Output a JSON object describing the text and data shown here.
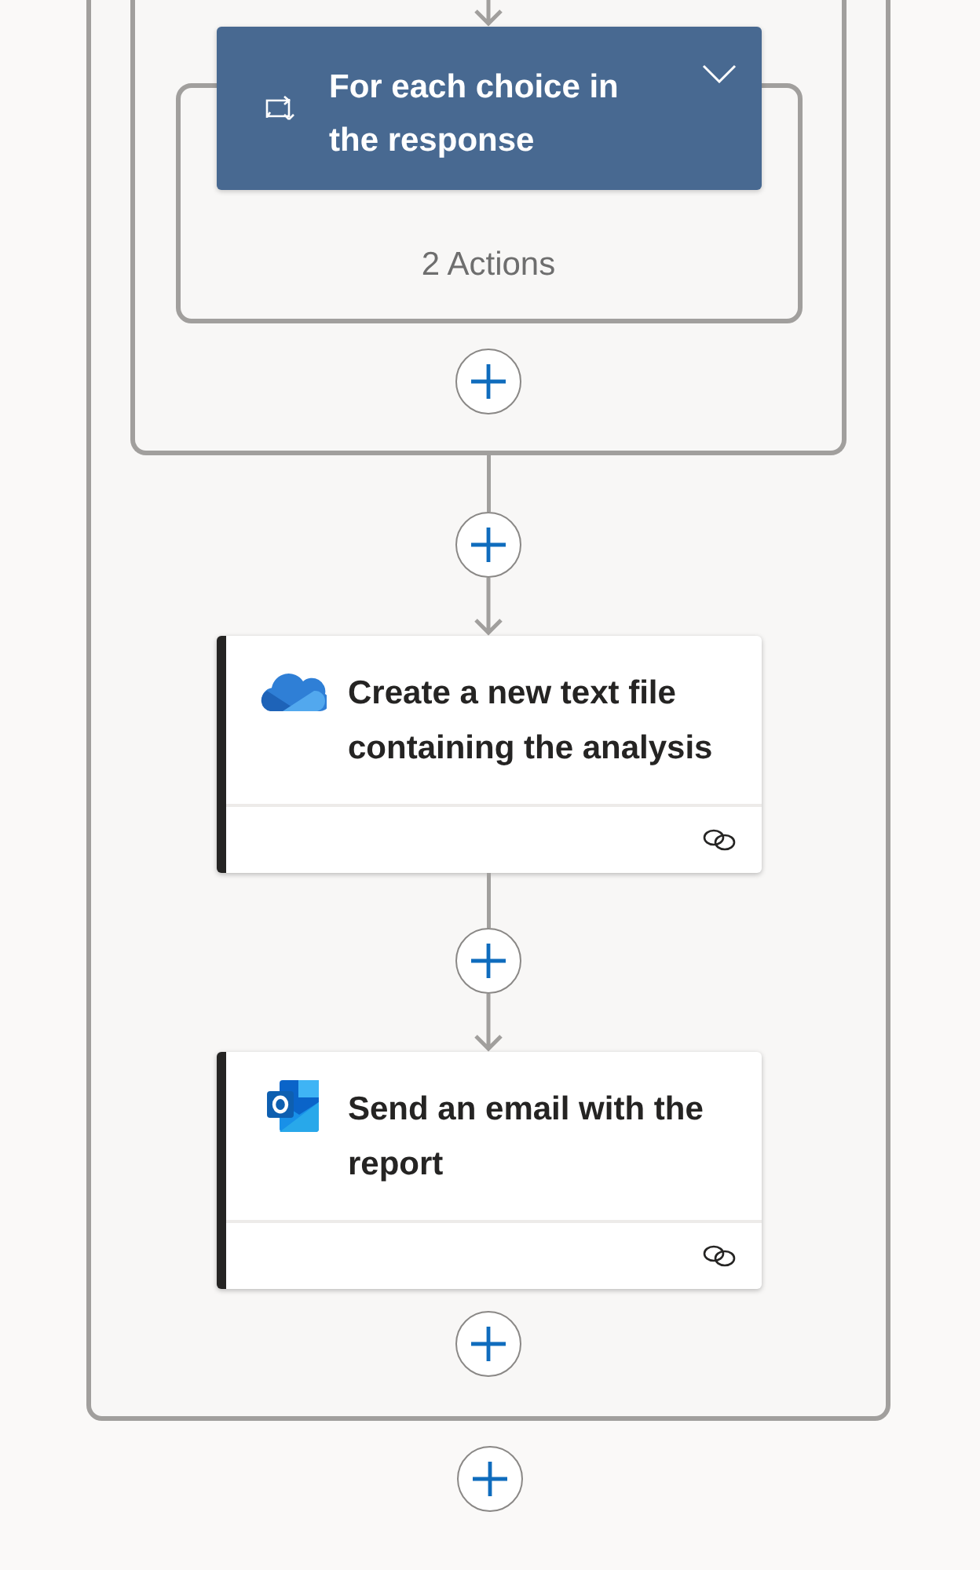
{
  "loop": {
    "title": "For each choice in the response",
    "summary": "2 Actions"
  },
  "actions": [
    {
      "kind": "onedrive",
      "title": "Create a new text file containing the analysis"
    },
    {
      "kind": "outlook",
      "title": "Send an email with the report"
    }
  ]
}
